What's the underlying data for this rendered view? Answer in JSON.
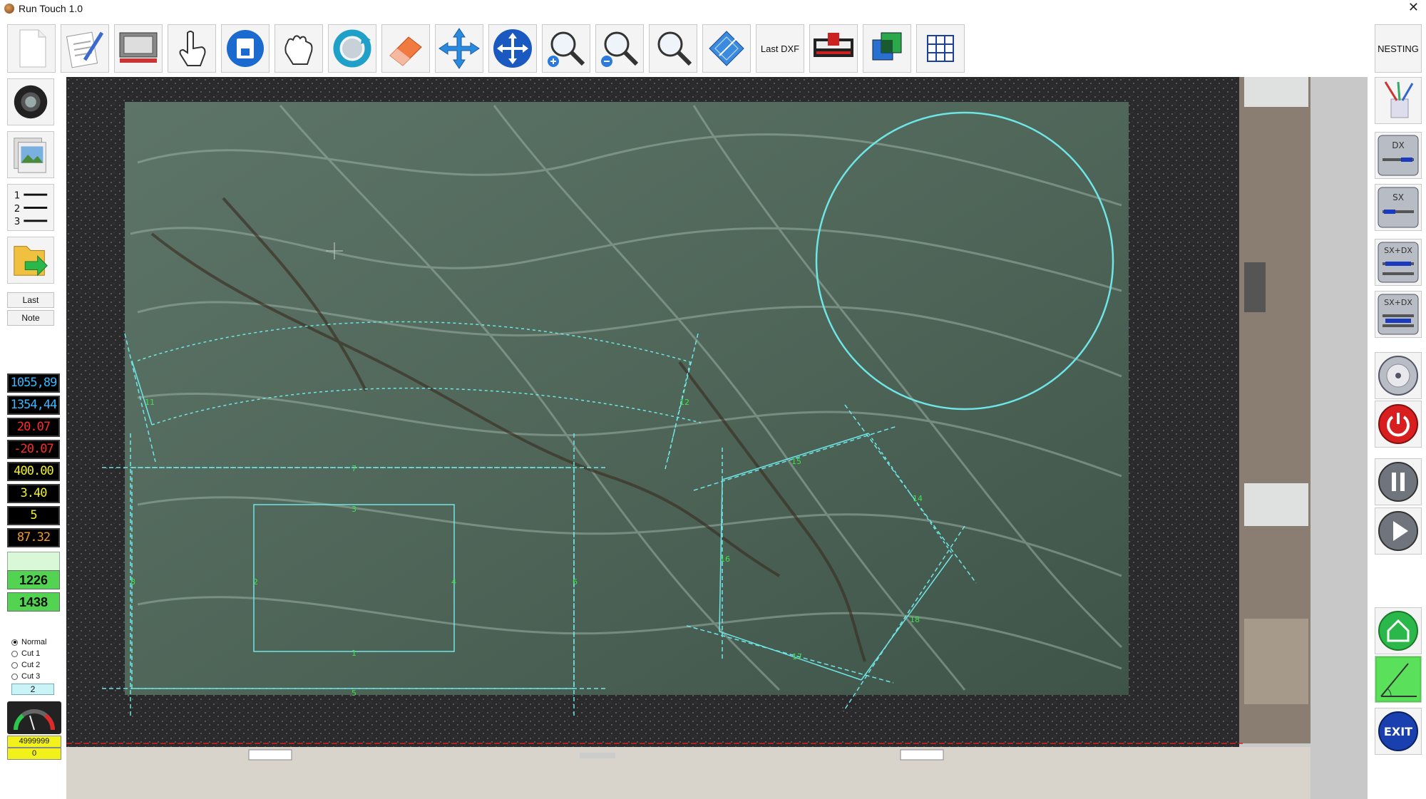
{
  "window": {
    "title": "Run Touch 1.0",
    "close_glyph": "✕"
  },
  "toolbar": {
    "items": [
      {
        "name": "new-document-icon"
      },
      {
        "name": "edit-document-icon"
      },
      {
        "name": "table-frame-icon"
      },
      {
        "name": "hand-pointer-icon"
      },
      {
        "name": "save-disk-icon"
      },
      {
        "name": "hand-grab-icon"
      },
      {
        "name": "rotate-icon"
      },
      {
        "name": "eraser-icon"
      },
      {
        "name": "move-arrows-icon"
      },
      {
        "name": "pan-arrows-icon"
      },
      {
        "name": "zoom-in-icon"
      },
      {
        "name": "zoom-out-icon"
      },
      {
        "name": "zoom-icon"
      },
      {
        "name": "blueprint-icon"
      },
      {
        "name": "last-dxf-button",
        "label": "Last DXF"
      },
      {
        "name": "saw-machine-icon"
      },
      {
        "name": "layers-icon"
      },
      {
        "name": "grid-icon"
      }
    ],
    "nesting_label": "NESTING"
  },
  "left_panel": {
    "last_label": "Last",
    "note_label": "Note",
    "list_numbers": [
      "1",
      "2",
      "3"
    ],
    "readouts": [
      {
        "value": "1055,89",
        "color": "#35b8ff"
      },
      {
        "value": "1354,44",
        "color": "#35b8ff"
      },
      {
        "value": "20.07",
        "color": "#ff2a2a"
      },
      {
        "value": "-20.07",
        "color": "#ff2a2a"
      },
      {
        "value": "400.00",
        "color": "#f2f21a"
      },
      {
        "value": "3.40",
        "color": "#f2f21a"
      },
      {
        "value": "5",
        "color": "#f2f21a"
      },
      {
        "value": "87.32",
        "color": "#f29a2a"
      }
    ],
    "green_values": [
      "",
      "1226",
      "1438"
    ],
    "modes": [
      "Normal",
      "Cut 1",
      "Cut 2",
      "Cut 3"
    ],
    "selected_mode": "Normal",
    "mode_number": "2",
    "counter_top": "4999999",
    "counter_bottom": "0"
  },
  "right_panel": {
    "labels": {
      "dx": "DX",
      "sx": "SX",
      "sxdx": "SX+DX",
      "exit": "EXIT"
    }
  },
  "canvas": {
    "segment_labels": [
      "11",
      "12",
      "13",
      "14",
      "15",
      "16",
      "17",
      "18",
      "7",
      "3",
      "2",
      "4",
      "1",
      "8",
      "6",
      "5"
    ],
    "colors": {
      "cut_line": "#6ee6e6",
      "label": "#3fe24a",
      "red_guide": "#e02020"
    }
  }
}
